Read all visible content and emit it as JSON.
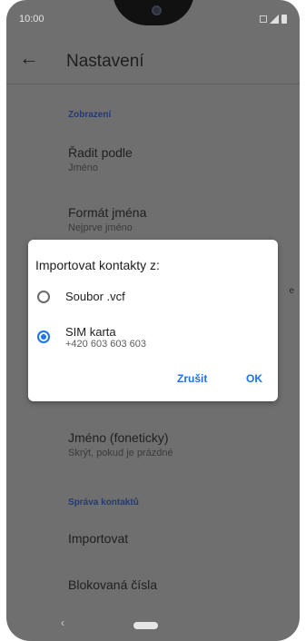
{
  "status": {
    "time": "10:00"
  },
  "appbar": {
    "title": "Nastavení"
  },
  "sections": {
    "display": "Zobrazení",
    "manage": "Správa kontaktů"
  },
  "settings": {
    "sort": {
      "title": "Řadit podle",
      "value": "Jméno"
    },
    "format": {
      "title": "Formát jména",
      "value": "Nejprve jméno"
    },
    "phonetic": {
      "title": "Jméno (foneticky)",
      "value": "Skrýt, pokud je prázdné"
    },
    "import": {
      "title": "Importovat"
    },
    "blocked": {
      "title": "Blokovaná čísla"
    },
    "edge_char": "e"
  },
  "dialog": {
    "title": "Importovat kontakty z:",
    "options": [
      {
        "label": "Soubor .vcf",
        "selected": false
      },
      {
        "label": "SIM karta",
        "sub": "+420 603 603 603",
        "selected": true
      }
    ],
    "cancel": "Zrušit",
    "ok": "OK"
  },
  "navbar": {
    "back": "‹"
  },
  "colors": {
    "accent": "#1a73e8",
    "scrim_background": "#6f6f6f",
    "section_header": "#233a73"
  }
}
